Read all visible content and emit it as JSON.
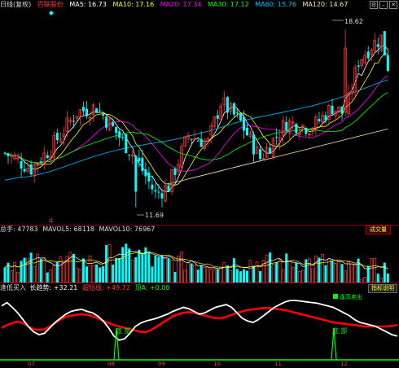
{
  "header": {
    "period": "日线(复权)",
    "stock": "百联股份",
    "ma": [
      {
        "label": "MA5: 16.73",
        "color": "#ffffff"
      },
      {
        "label": "MA10: 17.16",
        "color": "#ffff00"
      },
      {
        "label": "MA20: 17.34",
        "color": "#ff00ff"
      },
      {
        "label": "MA30: 17.12",
        "color": "#00ff00"
      },
      {
        "label": "MA60: 15.76",
        "color": "#00bfff"
      },
      {
        "label": "MA120: 14.67",
        "color": "#ffe4b5"
      }
    ]
  },
  "price_panel": {
    "high_label": "18.62",
    "low_label": "11.69",
    "marker_q": "q"
  },
  "volume_panel": {
    "total_label": "总手: 47783",
    "mavol5": "MAVOL5: 68118",
    "mavol10": "MAVOL10: 76967",
    "button": "成交量"
  },
  "indicator_panel": {
    "name": "逢低买入",
    "trend_label": "长趋势: +32.21",
    "short_label": "超短线: +49.72",
    "top_label": "顶A: +0.00",
    "button": "指标说明",
    "signal_bottom_1": "底 部",
    "signal_bottom_2": "底 部",
    "signal_sell": "逢高卖出"
  },
  "x_axis": [
    "07",
    "08",
    "09",
    "10",
    "11",
    "12"
  ],
  "chart_data": {
    "type": "candlestick",
    "indicator_lines": {
      "long_trend": [
        48,
        52,
        55,
        57,
        55,
        50,
        46,
        45,
        46,
        50,
        55,
        60,
        64,
        66,
        67,
        68,
        67,
        65,
        62,
        58,
        55,
        52,
        50,
        48,
        46,
        44,
        42,
        42,
        45,
        50,
        55,
        60,
        65,
        68,
        70,
        71,
        70,
        68,
        66,
        64,
        62,
        62,
        64,
        67,
        70,
        72,
        74,
        75,
        76,
        77,
        77,
        76,
        75,
        74,
        72,
        70,
        68,
        66,
        64,
        62,
        60,
        58,
        56,
        55,
        54,
        53,
        52,
        51,
        50,
        50,
        50,
        50,
        50,
        51,
        52
      ],
      "short_line": [
        80,
        85,
        78,
        70,
        60,
        50,
        42,
        38,
        40,
        48,
        56,
        62,
        68,
        72,
        74,
        75,
        72,
        70,
        65,
        58,
        48,
        36,
        30,
        32,
        40,
        50,
        55,
        58,
        60,
        62,
        65,
        68,
        72,
        75,
        78,
        76,
        72,
        68,
        70,
        74,
        78,
        80,
        82,
        78,
        70,
        62,
        58,
        56,
        60,
        66,
        72,
        78,
        82,
        86,
        88,
        88,
        87,
        86,
        85,
        84,
        82,
        80,
        78,
        74,
        70,
        66,
        60,
        56,
        54,
        52,
        50,
        46,
        42,
        38,
        36
      ]
    },
    "signals": [
      {
        "type": "bottom",
        "x_index": 17
      },
      {
        "type": "bottom",
        "x_index": 61
      }
    ]
  }
}
